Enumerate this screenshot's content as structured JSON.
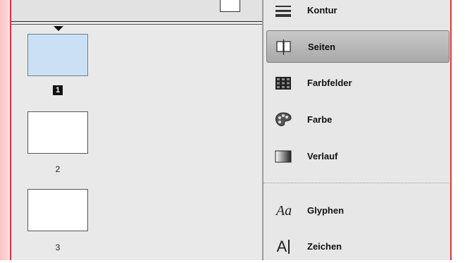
{
  "pages": {
    "items": [
      {
        "number": "1",
        "selected": true
      },
      {
        "number": "2",
        "selected": false
      },
      {
        "number": "3",
        "selected": false
      }
    ]
  },
  "panel": {
    "items": [
      {
        "icon": "stroke-lines-icon",
        "label": "Kontur"
      },
      {
        "icon": "pages-icon",
        "label": "Seiten",
        "active": true
      },
      {
        "icon": "swatches-grid-icon",
        "label": "Farbfelder"
      },
      {
        "icon": "color-palette-icon",
        "label": "Farbe"
      },
      {
        "icon": "gradient-icon",
        "label": "Verlauf"
      },
      {
        "icon": "glyphs-icon",
        "label": "Glyphen",
        "glyph": "Aa"
      },
      {
        "icon": "character-icon",
        "label": "Zeichen",
        "glyph": "A"
      }
    ]
  }
}
